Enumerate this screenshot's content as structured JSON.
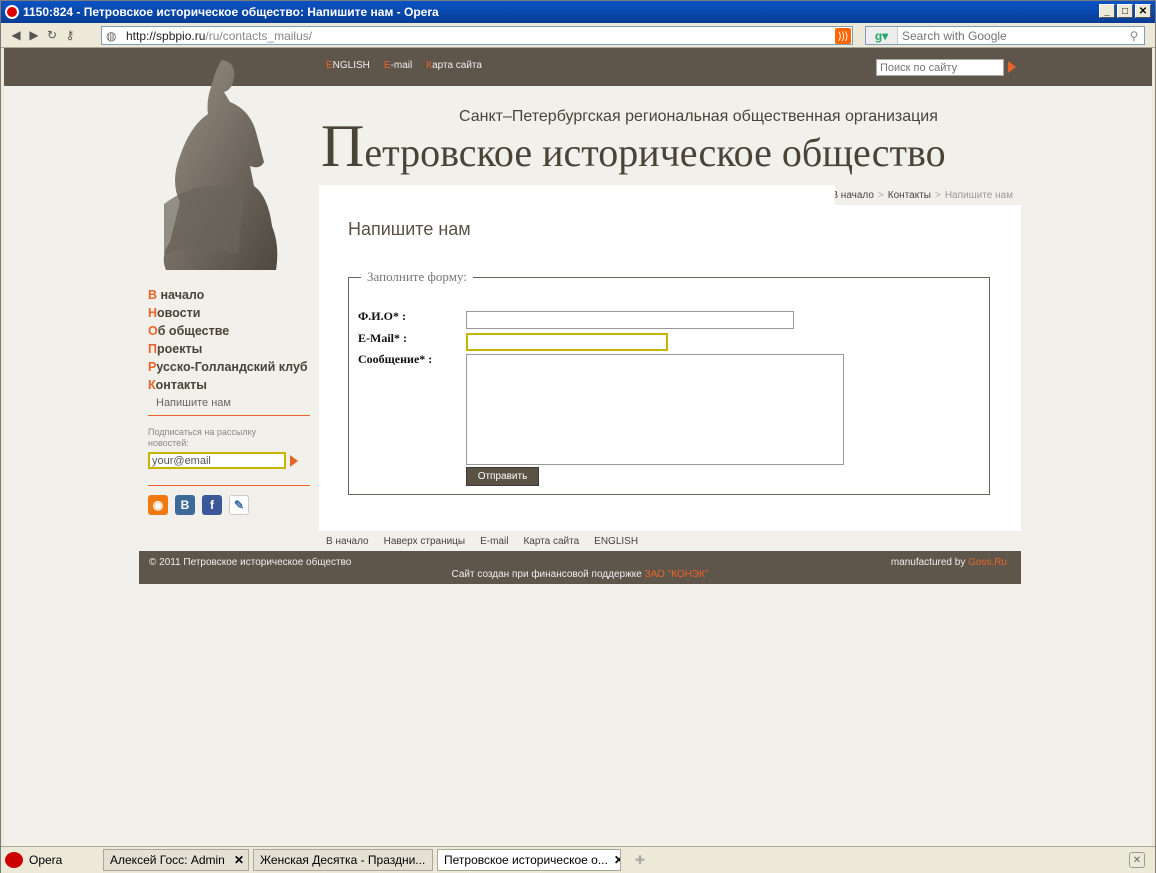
{
  "window": {
    "title": "1150:824 - Петровское историческое общество: Напишите нам - Opera"
  },
  "address": {
    "host": "http://spbpio.ru",
    "path": "/ru/contacts_mailus/"
  },
  "google_search": {
    "placeholder": "Search with Google"
  },
  "top_links": {
    "english": "ENGLISH",
    "email": "E-mail",
    "sitemap": "Карта сайта"
  },
  "site_search": {
    "placeholder": "Поиск по сайту"
  },
  "header": {
    "subtitle": "Санкт–Петербургская региональная общественная организация",
    "title_first": "П",
    "title_rest": "етровское историческое общество"
  },
  "breadcrumbs": {
    "home": "В начало",
    "contacts": "Контакты",
    "current": "Напишите нам",
    "sep": ">"
  },
  "page": {
    "title": "Напишите нам"
  },
  "form": {
    "legend": "Заполните форму:",
    "name_label": "Ф.И.О* :",
    "email_label": "E-Mail* :",
    "message_label": "Сообщение* :",
    "submit_label": "Отправить"
  },
  "nav": {
    "items": [
      {
        "first": "В",
        "rest": " начало"
      },
      {
        "first": "Н",
        "rest": "овости"
      },
      {
        "first": "О",
        "rest": "б обществе"
      },
      {
        "first": "П",
        "rest": "роекты"
      },
      {
        "first": "Р",
        "rest": "усско-Голландский клуб"
      },
      {
        "first": "К",
        "rest": "онтакты"
      }
    ],
    "sub": "Напишите нам"
  },
  "subscribe": {
    "label": "Подписаться на рассылку новостей:",
    "value": "your@email"
  },
  "social": {
    "rss": "rss-icon",
    "vk": "В",
    "fb": "f",
    "lj": "livejournal-icon"
  },
  "bottom_links": [
    "В начало",
    "Наверх страницы",
    "E-mail",
    "Карта сайта",
    "ENGLISH"
  ],
  "footer": {
    "copyright": "© 2011 Петровское историческое общество",
    "manufactured_prefix": "manufactured by ",
    "manufactured_link": "Goss.Ru",
    "support_prefix": "Сайт создан при финансовой поддержке ",
    "support_link": "ЗАО \"КОНЭК\""
  },
  "taskbar": {
    "opera": "Opera",
    "tabs": [
      "Алексей Госс: Admin",
      "Женская Десятка - Праздни...",
      "Петровское историческое о..."
    ]
  },
  "colors": {
    "accent": "#e8642a",
    "brown": "#5f564b",
    "focus": "#c8b400"
  }
}
